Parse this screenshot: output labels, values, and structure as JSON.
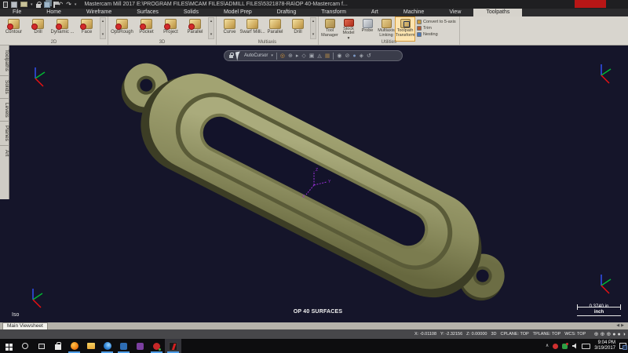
{
  "colors": {
    "viewport_bg": "#15152a",
    "part_olive": "#8f9060",
    "ribbon_bg": "#d8d5ce",
    "active_tab_bg": "#d6d3cc",
    "taskbar_underline": "#4f9ee8",
    "selection_highlight": "#d89c3c",
    "origin_marker": "#9b30d9"
  },
  "title_bar": {
    "title": "Mastercam Mill 2017   E:\\PROGRAM FILES\\MCAM FILES\\ADMILL FILES\\5321878-RA\\OP 40-Mastercam f..."
  },
  "ribbon": {
    "tabs": [
      "File",
      "Home",
      "Wireframe",
      "Surfaces",
      "Solids",
      "Model Prep",
      "Drafting",
      "Transform",
      "Art",
      "Machine",
      "View",
      "Toolpaths"
    ],
    "active_tab": "Toolpaths",
    "groups": [
      {
        "label": "2D",
        "buttons": [
          "Contour",
          "Drill",
          "Dynamic ...",
          "Face"
        ]
      },
      {
        "label": "3D",
        "buttons": [
          "OptiRough",
          "Pocket",
          "Project",
          "Parallel"
        ]
      },
      {
        "label": "Multiaxis",
        "buttons": [
          "Curve",
          "Swarf Milli...",
          "Parallel",
          "Drill"
        ]
      },
      {
        "label": "Utilities",
        "buttons": [
          "Tool Manager",
          "Stock Model",
          "Probe",
          "Multiaxis Linking",
          "Toolpath Transform"
        ]
      }
    ],
    "utilities_extra": [
      "Convert to 5-axis",
      "Trim",
      "Nesting"
    ]
  },
  "left_panel": {
    "tabs": [
      "Toolpaths",
      "Solids",
      "Levels",
      "Planes",
      "Art"
    ]
  },
  "viewport": {
    "overlay": {
      "autocursor": "AutoCursor"
    },
    "view_label": "Iso",
    "part_label": "OP 40 SURFACES",
    "scale_value": "0.3740 in",
    "scale_unit": "inch",
    "origin_axes": {
      "x": "X",
      "y": "Y",
      "z": "Z"
    }
  },
  "viewsheet": {
    "tab": "Main Viewsheet"
  },
  "status_bar": {
    "x": "X: -0.01108",
    "y": "Y: -2.32156",
    "z": "Z: 0.00000",
    "mode": "3D",
    "cplane": "CPLANE: TOP",
    "tplane": "TPLANE: TOP",
    "wcs": "WCS: TOP"
  },
  "taskbar": {
    "time": "9:04 PM",
    "date": "3/19/2017"
  },
  "icons": {
    "caret_down": "▾",
    "caret_up": "▴",
    "undo": "↶",
    "redo": "↷",
    "chevron_up": "∧",
    "tab_left": "◀",
    "tab_right": "▶",
    "axis_circle": "⊕",
    "dot_solid": "●",
    "dot_half": "◑",
    "overlay": [
      "◎",
      "⊕",
      "▸",
      "◇",
      "▣",
      "◬",
      "▦",
      "◉",
      "⊘",
      "●",
      "◈",
      "↺"
    ]
  }
}
